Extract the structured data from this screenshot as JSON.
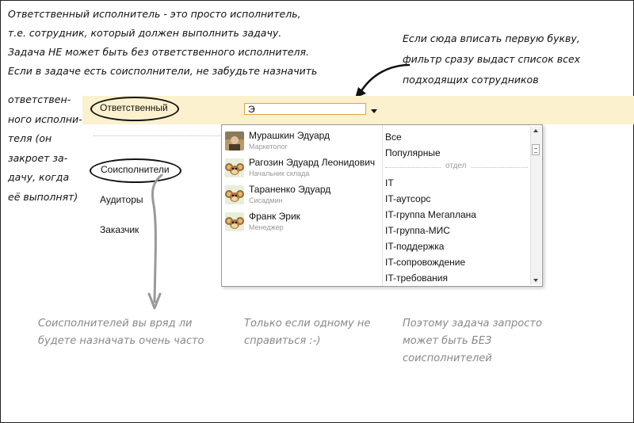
{
  "annotations": {
    "top_left": [
      "Ответственный исполнитель - это просто исполнитель,",
      "т.е. сотрудник, который должен выполнить задачу.",
      "Задача НЕ может быть без ответственного исполнителя.",
      "Если в задаче есть соисполнители, не забудьте назначить"
    ],
    "left_column": [
      "ответствен-",
      "ного исполни-",
      "теля (он",
      "закроет за-",
      "дачу, когда",
      "её выполнят)"
    ],
    "top_right": [
      "Если сюда вписать первую букву,",
      "фильтр сразу выдаст список всех",
      "подходящих сотрудников"
    ],
    "bottom_1": [
      "Соисполнителей вы вряд ли",
      "будете назначать очень часто"
    ],
    "bottom_2": [
      "Только если одному не",
      "справиться :-)"
    ],
    "bottom_3": [
      "Поэтому задача запросто",
      "может быть БЕЗ",
      "соисполнителей"
    ]
  },
  "roles": {
    "responsible": "Ответственный",
    "coexecutors": "Соисполнители",
    "auditors": "Аудиторы",
    "customer": "Заказчик"
  },
  "search": {
    "value": "Э"
  },
  "people": [
    {
      "name": "Мурашкин Эдуард",
      "role": "Маркетолог",
      "avatar": "photo"
    },
    {
      "name": "Рагозин Эдуард Леонидович",
      "role": "Начальник склада",
      "avatar": "cheburashka"
    },
    {
      "name": "Тараненко Эдуард",
      "role": "Сисадмин",
      "avatar": "cheburashka"
    },
    {
      "name": "Франк Эрик",
      "role": "Менеджер",
      "avatar": "cheburashka"
    }
  ],
  "groups_top": [
    "Все",
    "Популярные"
  ],
  "groups_separator": "отдел",
  "groups": [
    "IT",
    "IT-аутсорс",
    "IT-группа Мегаплана",
    "IT-группа-МИС",
    "IT-поддержка",
    "IT-сопровождение",
    "IT-требования"
  ],
  "colors": {
    "band": "#fbf1cf",
    "input_border": "#d8a640",
    "muted": "#999999"
  }
}
